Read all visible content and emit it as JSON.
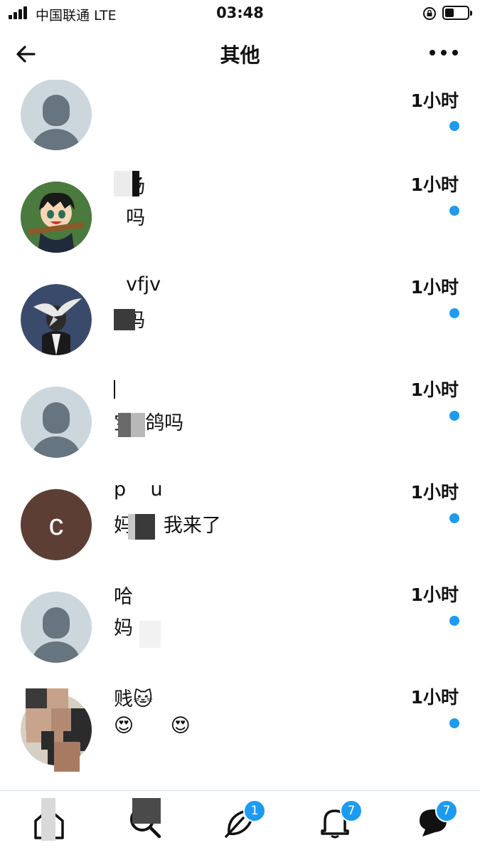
{
  "status_bar": {
    "carrier": "中国联通  LTE",
    "time": "03:48"
  },
  "header": {
    "title": "其他",
    "back_icon": "arrow-left-icon",
    "more_icon": "more-horizontal-icon"
  },
  "conversations": [
    {
      "name": "",
      "message": "",
      "time": "1小时",
      "unread": true,
      "avatar": "default"
    },
    {
      "name": "  扬",
      "message": "  吗",
      "time": "1小时",
      "unread": true,
      "avatar": "illustration"
    },
    {
      "name": "  vfjv",
      "message": "  吗",
      "time": "1小时",
      "unread": true,
      "avatar": "photo"
    },
    {
      "name": "",
      "message": "宝  鸽吗",
      "time": "1小时",
      "unread": true,
      "avatar": "default"
    },
    {
      "name": "p    u",
      "message": "妈     我来了",
      "time": "1小时",
      "unread": true,
      "avatar": "letter",
      "avatar_letter": "c"
    },
    {
      "name": "哈",
      "message": "妈",
      "time": "1小时",
      "unread": true,
      "avatar": "default"
    },
    {
      "name": "贱🐱",
      "message": "😍      😍",
      "time": "1小时",
      "unread": true,
      "avatar": "photo"
    }
  ],
  "tab_bar": [
    {
      "name": "home",
      "icon": "home-icon",
      "badge": ""
    },
    {
      "name": "search",
      "icon": "search-icon",
      "badge": ""
    },
    {
      "name": "spaces",
      "icon": "feather-icon",
      "badge": "1"
    },
    {
      "name": "notifications",
      "icon": "bell-icon",
      "badge": "7"
    },
    {
      "name": "messages",
      "icon": "message-icon",
      "badge": "7"
    }
  ],
  "colors": {
    "accent": "#1d9bf0",
    "default_avatar_bg": "#ccd6dd",
    "default_avatar_fg": "#66757f",
    "letter_avatar_bg": "#5d3e34"
  }
}
